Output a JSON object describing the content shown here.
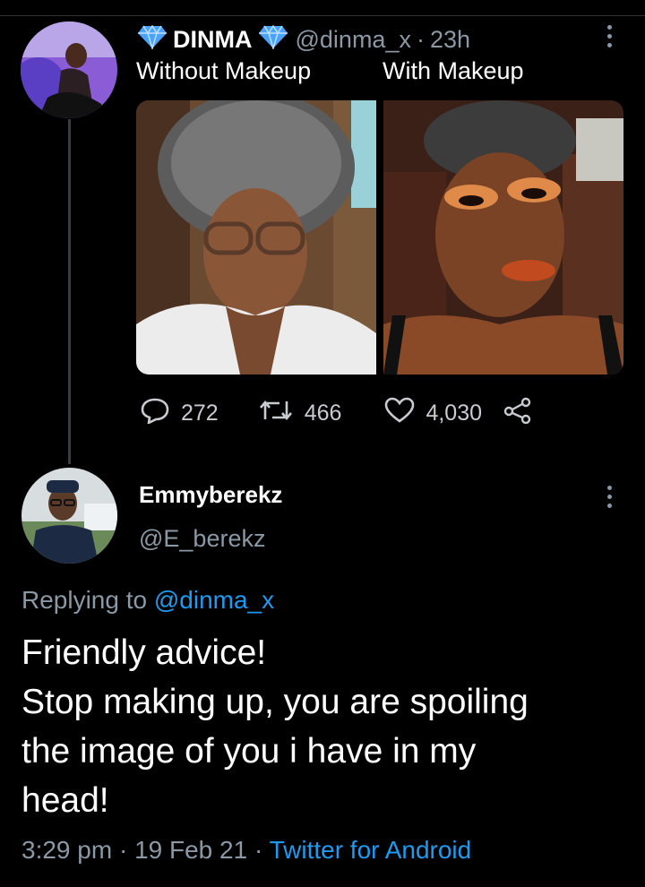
{
  "tweet": {
    "display_name": "DINMA",
    "handle": "@dinma_x",
    "separator": "·",
    "time": "23h",
    "caption_left": "Without Makeup",
    "caption_right": "With Makeup",
    "stats": {
      "replies": "272",
      "retweets": "466",
      "likes": "4,030"
    }
  },
  "reply": {
    "display_name": "Emmyberekz",
    "handle": "@E_berekz",
    "replying_prefix": "Replying to",
    "replying_to": "@dinma_x",
    "lines": [
      "Friendly advice!",
      "Stop making up, you are spoiling",
      "the image of you i have in my",
      "head!"
    ],
    "time": "3:29 pm",
    "date": "19 Feb 21",
    "source": "Twitter for Android",
    "dot": "·"
  },
  "colors": {
    "background": "#000000",
    "secondary_text": "#8b98a5",
    "link": "#1d9bf0",
    "verified_blue": "#4aa3ff"
  }
}
